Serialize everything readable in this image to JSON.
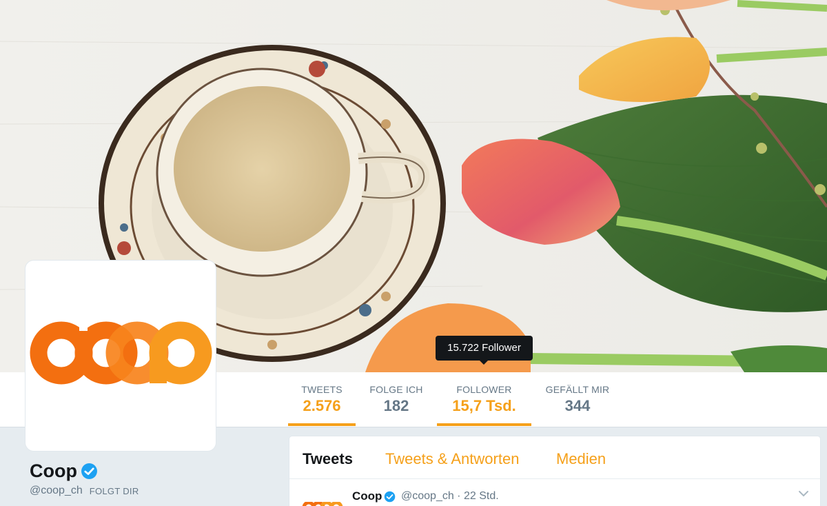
{
  "stats": [
    {
      "label": "TWEETS",
      "value": "2.576"
    },
    {
      "label": "FOLGE ICH",
      "value": "182"
    },
    {
      "label": "FOLLOWER",
      "value": "15,7 Tsd."
    },
    {
      "label": "GEFÄLLT MIR",
      "value": "344"
    }
  ],
  "tooltip": "15.722 Follower",
  "profile": {
    "name": "Coop",
    "handle": "@coop_ch",
    "follows_you": "FOLGT DIR",
    "logo_text": "coop"
  },
  "tabs": [
    {
      "label": "Tweets"
    },
    {
      "label": "Tweets & Antworten"
    },
    {
      "label": "Medien"
    }
  ],
  "tweet": {
    "name": "Coop",
    "meta": "@coop_ch · 22 Std."
  },
  "colors": {
    "accent": "#f5a01a",
    "coop_orange": "#f36f10",
    "coop_orange_light": "#f79a1f",
    "verified_blue": "#1da1f2"
  }
}
